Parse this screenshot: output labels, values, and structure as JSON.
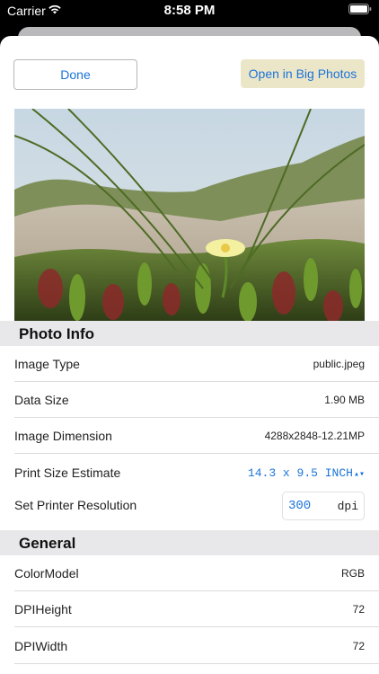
{
  "status_bar": {
    "carrier": "Carrier",
    "time": "8:58 PM"
  },
  "buttons": {
    "done": "Done",
    "open": "Open in Big Photos"
  },
  "photo_info": {
    "header": "Photo Info",
    "rows": [
      {
        "label": "Image Type",
        "value": "public.jpeg"
      },
      {
        "label": "Data Size",
        "value": "1.90 MB"
      },
      {
        "label": "Image Dimension",
        "value": "4288x2848-12.21MP"
      }
    ],
    "print_size": {
      "label": "Print Size Estimate",
      "value": "14.3 x 9.5 INCH"
    },
    "printer_resolution": {
      "label": "Set Printer Resolution",
      "value": "300",
      "unit": "dpi"
    }
  },
  "general": {
    "header": "General",
    "rows": [
      {
        "label": "ColorModel",
        "value": "RGB"
      },
      {
        "label": "DPIHeight",
        "value": "72"
      },
      {
        "label": "DPIWidth",
        "value": "72"
      }
    ]
  },
  "colors": {
    "accent": "#1a73d9",
    "open_button_bg": "#ece6c9",
    "section_bg": "#e8e8ea"
  }
}
